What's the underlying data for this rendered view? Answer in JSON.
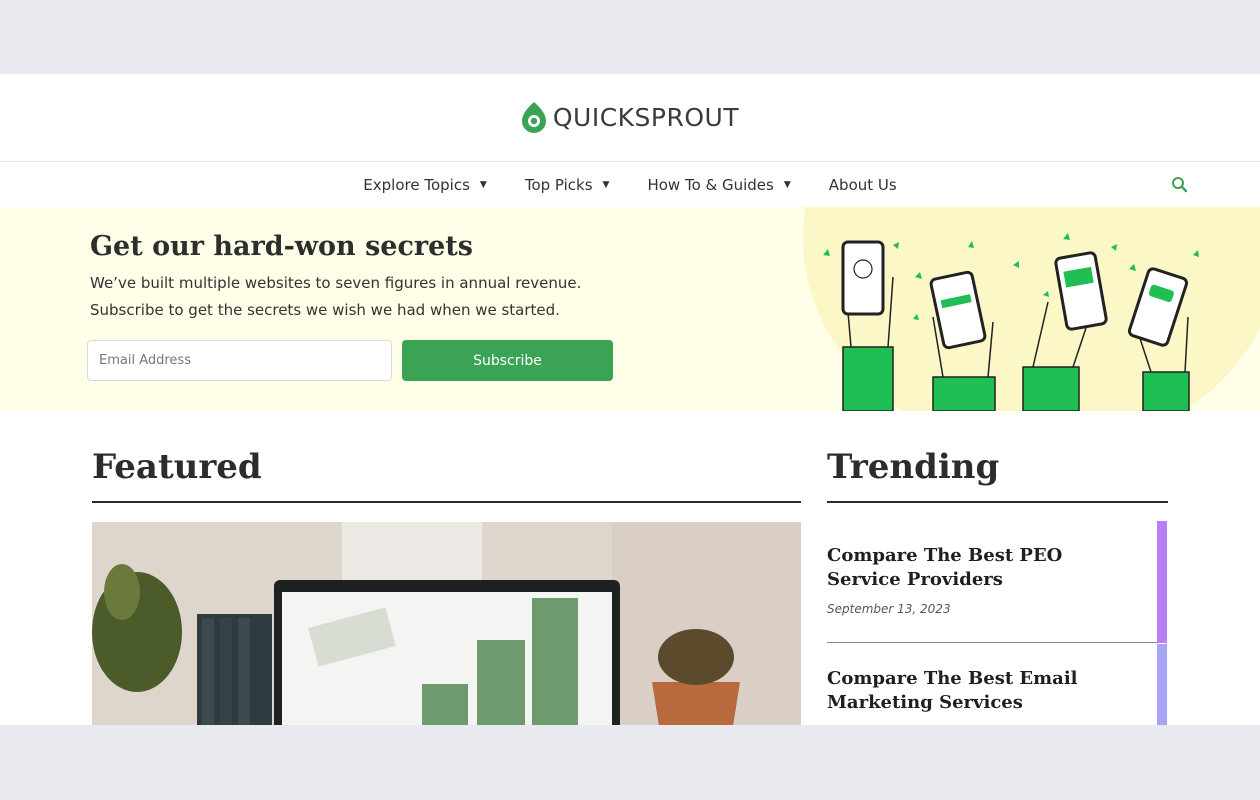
{
  "brand": {
    "name": "QUICKSPROUT",
    "accent_color": "#3ba354",
    "logo_icon": "leaf-pin-icon"
  },
  "nav": {
    "items": [
      {
        "label": "Explore Topics",
        "has_dropdown": true
      },
      {
        "label": "Top Picks",
        "has_dropdown": true
      },
      {
        "label": "How To & Guides",
        "has_dropdown": true
      },
      {
        "label": "About Us",
        "has_dropdown": false
      }
    ],
    "search_icon": "search-icon"
  },
  "hero": {
    "title": "Get our hard-won secrets",
    "line1": "We’ve built multiple websites to seven figures in annual revenue.",
    "line2": "Subscribe to get the secrets we wish we had when we started.",
    "email_placeholder": "Email Address",
    "email_value": "",
    "subscribe_label": "Subscribe",
    "background_color": "#fefee9",
    "illustration": "hands-holding-phones-illustration"
  },
  "featured": {
    "title": "Featured",
    "image": "laptop-with-money-bar-chart-photo"
  },
  "trending": {
    "title": "Trending",
    "items": [
      {
        "title": "Compare The Best PEO Service Providers",
        "date": "September 13, 2023",
        "accent": "#b77ef7"
      },
      {
        "title": "Compare The Best Email Marketing Services",
        "date": "",
        "accent": "#a8a4f7"
      }
    ]
  }
}
